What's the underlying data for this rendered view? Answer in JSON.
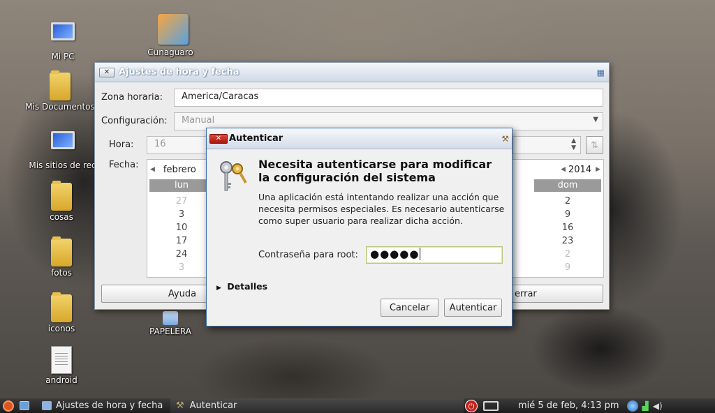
{
  "desktop": {
    "icons": [
      {
        "label": "Mi PC"
      },
      {
        "label": "Cunaguaro"
      },
      {
        "label": "Mis Documentos"
      },
      {
        "label": "Mis sitios de red"
      },
      {
        "label": "cosas"
      },
      {
        "label": "fotos"
      },
      {
        "label": "iconos"
      },
      {
        "label": "PAPELERA"
      },
      {
        "label": "android"
      }
    ]
  },
  "main_window": {
    "title": "Ajustes de hora y fecha",
    "timezone_label": "Zona horaria:",
    "timezone_value": "America/Caracas",
    "config_label": "Configuración:",
    "config_value": "Manual",
    "time_label": "Hora:",
    "time_value": "16",
    "date_label": "Fecha:",
    "calendar": {
      "month": "febrero",
      "year": "2014",
      "day_headers": [
        "lun",
        "dom"
      ],
      "col_lun": [
        "27",
        "3",
        "10",
        "17",
        "24",
        "3"
      ],
      "col_dom": [
        "2",
        "9",
        "16",
        "23",
        "2",
        "9"
      ]
    },
    "help_button": "Ayuda",
    "close_button": "errar"
  },
  "auth_dialog": {
    "title": "Autenticar",
    "heading": "Necesita autenticarse para modificar la configuración del sistema",
    "description": "Una aplicación está intentando realizar una acción que necesita permisos especiales. Es necesario autenticarse como super usuario para realizar dicha acción.",
    "password_label": "Contraseña para root:",
    "password_value": "●●●●●",
    "details_label": "Detalles",
    "cancel_button": "Cancelar",
    "auth_button": "Autenticar"
  },
  "taskbar": {
    "items": [
      {
        "label": "Ajustes de hora y fecha"
      },
      {
        "label": "Autenticar"
      }
    ],
    "clock": "mié  5 de feb,  4:13 pm"
  },
  "colors": {
    "dialog_border": "#3c6fa8",
    "close_red": "#c62a1e",
    "taskbar": "#2a2a2a"
  }
}
